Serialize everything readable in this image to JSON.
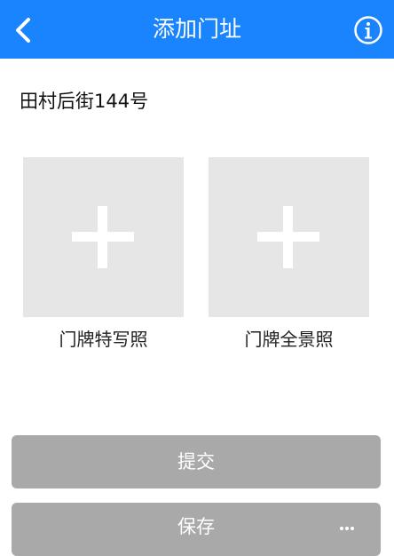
{
  "header": {
    "title": "添加门址",
    "back_icon": "chevron-left-icon",
    "info_icon": "info-icon"
  },
  "address": "田村后街144号",
  "photos": [
    {
      "label": "门牌特写照",
      "icon": "plus-icon"
    },
    {
      "label": "门牌全景照",
      "icon": "plus-icon"
    }
  ],
  "buttons": {
    "submit_label": "提交",
    "save_label": "保存"
  },
  "colors": {
    "header_bg": "#1a84ff",
    "photo_slot_bg": "#e6e6e6",
    "button_bg": "#a9a9a9"
  }
}
